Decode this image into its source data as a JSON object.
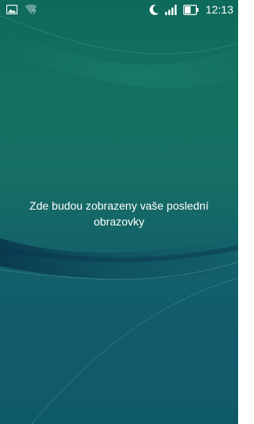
{
  "status_bar": {
    "time": "12:13",
    "wifi_status": "?",
    "icons": {
      "left": [
        "image-icon",
        "wifi-unknown-icon"
      ],
      "right": [
        "moon-icon",
        "signal-icon",
        "battery-icon"
      ]
    },
    "battery_level": 0.55,
    "signal_bars": 4
  },
  "recents": {
    "empty_message": "Zde budou zobrazeny vaše poslední obrazovky"
  },
  "colors": {
    "wallpaper_top": "#0e6a5a",
    "wallpaper_bottom": "#0f5a6a",
    "text": "#ffffff"
  }
}
